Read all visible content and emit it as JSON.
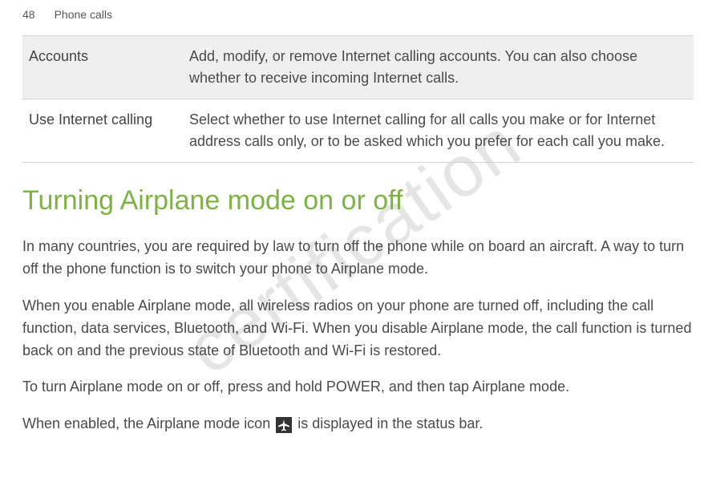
{
  "header": {
    "pageNumber": "48",
    "sectionName": "Phone calls"
  },
  "watermark": "certification",
  "table": {
    "rows": [
      {
        "label": "Accounts",
        "description": "Add, modify, or remove Internet calling accounts. You can also choose whether to receive incoming Internet calls."
      },
      {
        "label": "Use Internet calling",
        "description": "Select whether to use Internet calling for all calls you make or for Internet address calls only, or to be asked which you prefer for each call you make."
      }
    ]
  },
  "heading": "Turning Airplane mode on or off",
  "paragraphs": {
    "p1": "In many countries, you are required by law to turn off the phone while on board an aircraft. A way to turn off the phone function is to switch your phone to Airplane mode.",
    "p2": "When you enable Airplane mode, all wireless radios on your phone are turned off, including the call function, data services, Bluetooth, and Wi-Fi. When you disable Airplane mode, the call function is turned back on and the previous state of Bluetooth and Wi-Fi is restored.",
    "p3_part1": "To turn Airplane mode on or off, press and hold POWER, and then tap ",
    "p3_part2": "Airplane mode",
    "p3_part3": ".",
    "p4_part1": "When enabled, the Airplane mode icon ",
    "p4_part2": " is displayed in the status bar."
  }
}
